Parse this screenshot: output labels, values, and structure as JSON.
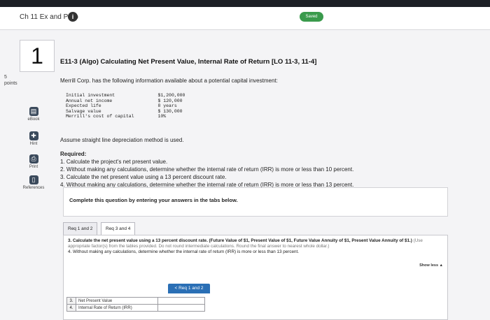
{
  "header": {
    "title": "Ch 11 Ex and Prob",
    "info_icon": "i",
    "saved_label": "Saved"
  },
  "sidebar": {
    "question_number": "1",
    "points_value": "5",
    "points_label": "points",
    "buttons": [
      {
        "label": "eBook",
        "icon": "book-icon"
      },
      {
        "label": "Hint",
        "icon": "hint-icon"
      },
      {
        "label": "Print",
        "icon": "print-icon"
      },
      {
        "label": "References",
        "icon": "references-icon"
      }
    ]
  },
  "question": {
    "title": "E11-3 (Algo) Calculating Net Present Value, Internal Rate of Return [LO 11-3, 11-4]",
    "intro": "Merrill Corp. has the following information available about a potential capital investment:",
    "data_rows": [
      {
        "label": "Initial investment",
        "value": "$1,200,000"
      },
      {
        "label": "Annual net income",
        "value": "$ 120,000"
      },
      {
        "label": "Expected life",
        "value": "8 years"
      },
      {
        "label": "Salvage value",
        "value": "$ 130,000"
      },
      {
        "label": "Merrill's cost of capital",
        "value": "10%"
      }
    ],
    "assumption": "Assume straight line depreciation method is used.",
    "required_heading": "Required:",
    "required_items": [
      "1. Calculate the project's net present value.",
      "2. Without making any calculations, determine whether the internal rate of return (IRR) is more or less than 10 percent.",
      "3. Calculate the net present value using a 13 percent discount rate.",
      "4. Without making any calculations, determine whether the internal rate of return (IRR) is more or less than 13 percent."
    ]
  },
  "panel": {
    "instruction": "Complete this question by entering your answers in the tabs below."
  },
  "tabs": [
    {
      "label": "Req 1 and 2",
      "active": false
    },
    {
      "label": "Req 3 and 4",
      "active": true
    }
  ],
  "tab_content": {
    "instruction_bold": "3. Calculate the net present value using a 13 percent discount rate. (Future Value of $1, Present Value of $1, Future Value Annuity of $1, Present Value Annuity of $1.)",
    "instruction_gray": "(Use appropriate factor(s) from the tables provided. Do not round intermediate calculations. Round the final answer to nearest whole dollar.)",
    "instruction_line4": "4. Without making any calculations, determine whether the internal rate of return (IRR) is more or less than 13 percent.",
    "show_less": "Show less ▲",
    "answer_rows": [
      {
        "num": "3.",
        "label": "Net Present Value",
        "value": ""
      },
      {
        "num": "4.",
        "label": "Internal Rate of Return (IRR)",
        "value": ""
      }
    ],
    "prev_button": "< Req 1 and 2"
  }
}
